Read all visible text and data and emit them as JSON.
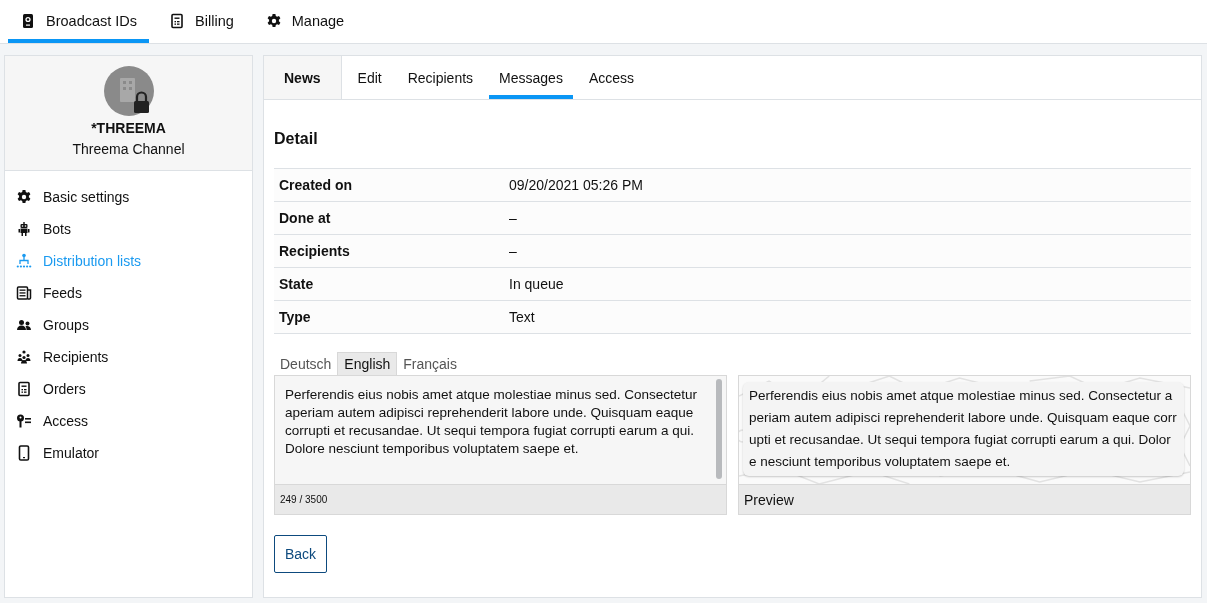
{
  "top_nav": [
    {
      "label": "Broadcast IDs",
      "selected": true
    },
    {
      "label": "Billing",
      "selected": false
    },
    {
      "label": "Manage",
      "selected": false
    }
  ],
  "profile": {
    "id": "*THREEMA",
    "name": "Threema Channel"
  },
  "sidebar": {
    "items": [
      {
        "label": "Basic settings",
        "selected": false
      },
      {
        "label": "Bots",
        "selected": false
      },
      {
        "label": "Distribution lists",
        "selected": true
      },
      {
        "label": "Feeds",
        "selected": false
      },
      {
        "label": "Groups",
        "selected": false
      },
      {
        "label": "Recipients",
        "selected": false
      },
      {
        "label": "Orders",
        "selected": false
      },
      {
        "label": "Access",
        "selected": false
      },
      {
        "label": "Emulator",
        "selected": false
      }
    ]
  },
  "section_title": "News",
  "tabs": [
    {
      "label": "Edit",
      "selected": false
    },
    {
      "label": "Recipients",
      "selected": false
    },
    {
      "label": "Messages",
      "selected": true
    },
    {
      "label": "Access",
      "selected": false
    }
  ],
  "detail": {
    "title": "Detail",
    "rows": [
      {
        "label": "Created on",
        "value": "09/20/2021 05:26 PM"
      },
      {
        "label": "Done at",
        "value": "–"
      },
      {
        "label": "Recipients",
        "value": "–"
      },
      {
        "label": "State",
        "value": "In queue"
      },
      {
        "label": "Type",
        "value": "Text"
      }
    ]
  },
  "language_tabs": [
    {
      "label": "Deutsch",
      "selected": false
    },
    {
      "label": "English",
      "selected": true
    },
    {
      "label": "Français",
      "selected": false
    }
  ],
  "message_field": {
    "value": "Perferendis eius nobis amet atque molestiae minus sed. Consectetur aperiam autem adipisci reprehenderit labore unde. Quisquam eaque corrupti et recusandae. Ut sequi tempora fugiat corrupti earum a qui. Dolore nesciunt temporibus voluptatem saepe et.",
    "counter": "249 / 3500"
  },
  "preview": {
    "text": "Perferendis eius nobis amet atque molestiae minus sed. Consectetur aperiam autem adipisci reprehenderit labore unde. Quisquam eaque corrupti et recusandae. Ut sequi tempora fugiat corrupti earum a qui. Dolore nesciunt temporibus voluptatem saepe et.",
    "label": "Preview"
  },
  "buttons": [
    "Back"
  ]
}
